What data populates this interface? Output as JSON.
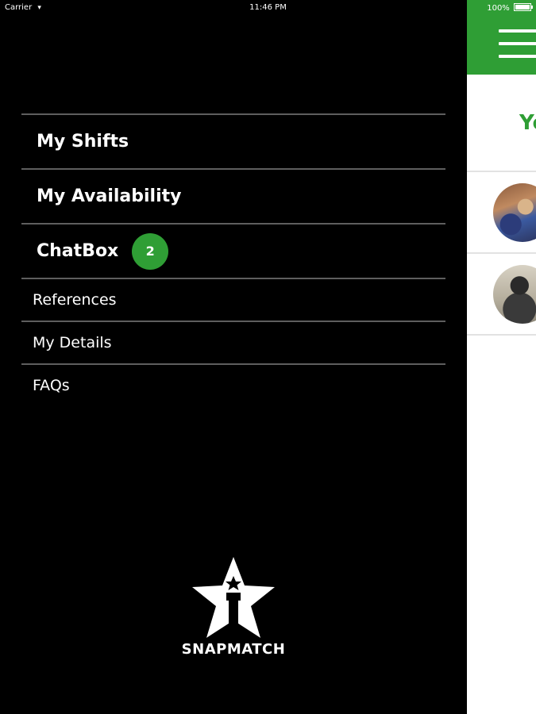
{
  "status_bar": {
    "carrier": "Carrier",
    "time": "11:46 PM",
    "battery": "100%"
  },
  "drawer": {
    "menu": [
      {
        "label": "My Shifts"
      },
      {
        "label": "My Availability"
      },
      {
        "label": "ChatBox",
        "badge": "2"
      },
      {
        "label": "References"
      },
      {
        "label": "My Details"
      },
      {
        "label": "FAQs"
      }
    ],
    "logo_text": "SNAPMATCH"
  },
  "main": {
    "title_partial": "Yo"
  },
  "colors": {
    "brand_green": "#2f9e35",
    "drawer_bg": "#000000",
    "divider": "#5e5e5e"
  },
  "icons": [
    "wifi-icon",
    "battery-icon",
    "hamburger-menu-icon",
    "snapmatch-star-logo"
  ]
}
